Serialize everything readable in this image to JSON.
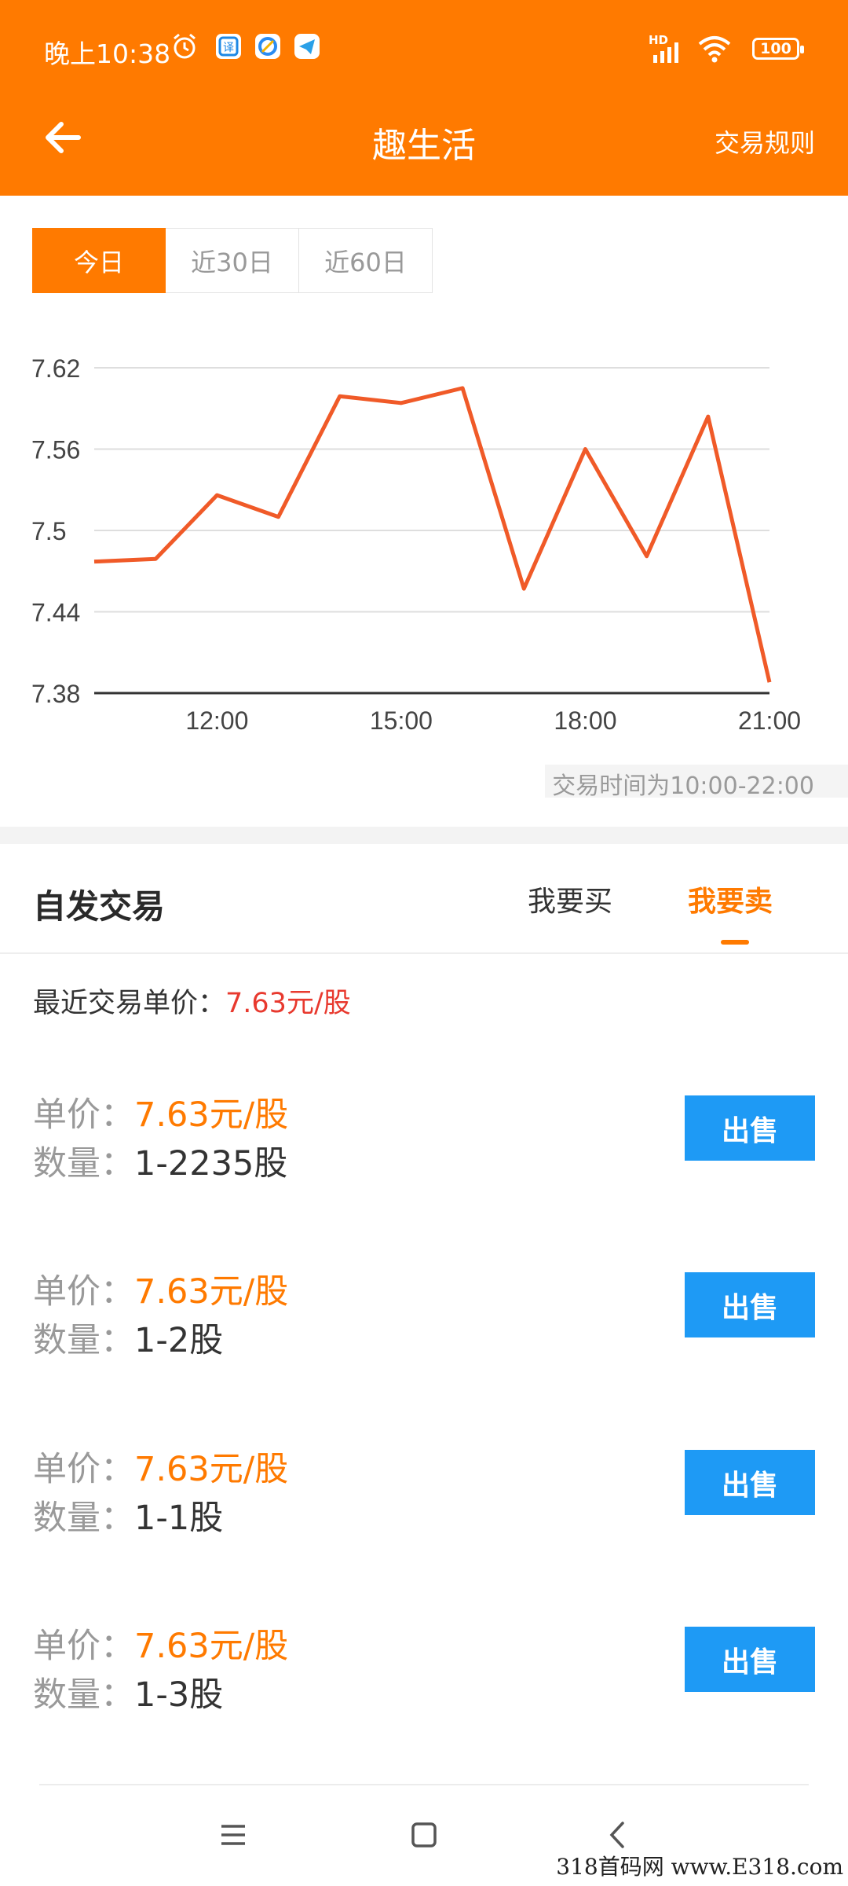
{
  "status_bar": {
    "time": "晚上10:38",
    "battery": "100",
    "hd": "HD",
    "icons": [
      "alarm-icon",
      "app-translate-icon",
      "app-browser-icon",
      "telegram-icon",
      "signal-icon",
      "wifi-icon",
      "battery-icon"
    ]
  },
  "nav": {
    "back_icon": "arrow-left-icon",
    "title": "趣生活",
    "rules": "交易规则"
  },
  "period_tabs": [
    {
      "label": "今日",
      "active": true
    },
    {
      "label": "近30日",
      "active": false
    },
    {
      "label": "近60日",
      "active": false
    }
  ],
  "chart_data": {
    "type": "line",
    "x_ticks": [
      "12:00",
      "15:00",
      "18:00",
      "21:00"
    ],
    "y_ticks": [
      "7.62",
      "7.56",
      "7.5",
      "7.44",
      "7.38"
    ],
    "ylim": [
      7.38,
      7.62
    ],
    "series": [
      {
        "color": "#f05a28",
        "points": [
          {
            "x": 10.0,
            "y": 7.477
          },
          {
            "x": 11.0,
            "y": 7.479
          },
          {
            "x": 12.0,
            "y": 7.526
          },
          {
            "x": 13.0,
            "y": 7.51
          },
          {
            "x": 14.0,
            "y": 7.599
          },
          {
            "x": 15.0,
            "y": 7.594
          },
          {
            "x": 16.0,
            "y": 7.605
          },
          {
            "x": 17.0,
            "y": 7.457
          },
          {
            "x": 18.0,
            "y": 7.56
          },
          {
            "x": 19.0,
            "y": 7.481
          },
          {
            "x": 20.0,
            "y": 7.584
          },
          {
            "x": 21.0,
            "y": 7.388
          }
        ]
      }
    ],
    "xlim": [
      10.0,
      21.0
    ],
    "grid": true
  },
  "trading_note": "交易时间为10:00-22:00",
  "section": {
    "title": "自发交易",
    "buy_tab": "我要买",
    "sell_tab": "我要卖"
  },
  "recent": {
    "label": "最近交易单价：",
    "price": "7.63元/股"
  },
  "listings": [
    {
      "price_label": "单价：",
      "price": "7.63元/股",
      "qty_label": "数量：",
      "qty": "1-2235股",
      "button": "出售"
    },
    {
      "price_label": "单价：",
      "price": "7.63元/股",
      "qty_label": "数量：",
      "qty": "1-2股",
      "button": "出售"
    },
    {
      "price_label": "单价：",
      "price": "7.63元/股",
      "qty_label": "数量：",
      "qty": "1-1股",
      "button": "出售"
    },
    {
      "price_label": "单价：",
      "price": "7.63元/股",
      "qty_label": "数量：",
      "qty": "1-3股",
      "button": "出售"
    }
  ],
  "system_nav": [
    "menu-icon",
    "home-icon",
    "back-icon"
  ],
  "watermark": "318首码网 www.E318.com",
  "colors": {
    "accent": "#ff7a00",
    "sell_button": "#1e9af5",
    "recent_price": "#e8392e",
    "line": "#f05a28"
  }
}
